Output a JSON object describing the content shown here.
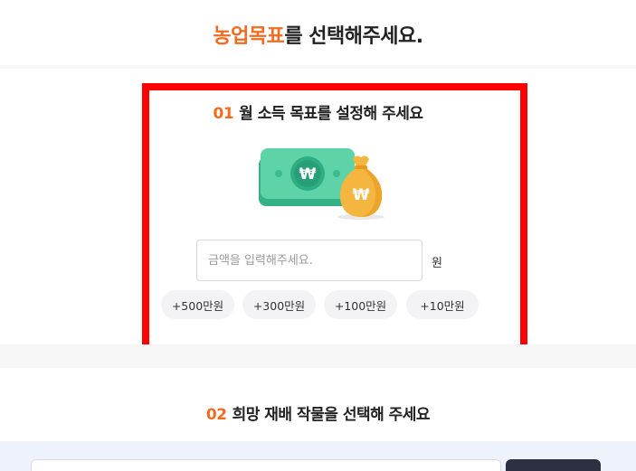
{
  "header": {
    "title_accent": "농업목표",
    "title_rest": "를 선택해주세요."
  },
  "section1": {
    "number": "01",
    "heading": "월 소득 목표를 설정해 주세요",
    "illustration": {
      "bill_icon": "won-bill-icon",
      "bag_icon": "money-bag-icon",
      "symbol": "₩",
      "colors": {
        "bill": "#5fd3a8",
        "bill_dark": "#34b187",
        "bag": "#f5b640",
        "bag_dark": "#e59a1e"
      }
    },
    "amount_input": {
      "value": "",
      "placeholder": "금액을 입력해주세요."
    },
    "unit": "원",
    "quick_amounts": [
      "+500만원",
      "+300만원",
      "+100만원",
      "+10만원"
    ]
  },
  "section2": {
    "number": "02",
    "heading": "희망 재배 작물을 선택해 주세요"
  },
  "colors": {
    "accent": "#f26b21",
    "highlight": "#ff0000",
    "dark_button": "#2d3040",
    "bottom_strip": "#eef3fb"
  }
}
